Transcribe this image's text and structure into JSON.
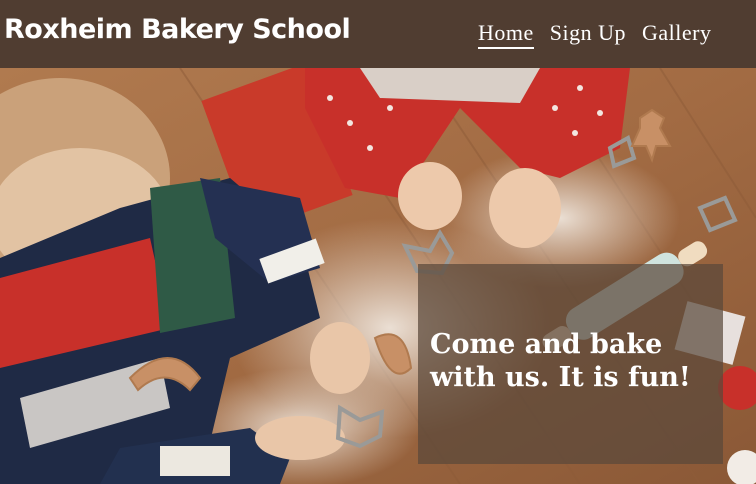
{
  "header": {
    "brand": "Roxheim Bakery School",
    "nav": [
      {
        "label": "Home",
        "active": true
      },
      {
        "label": "Sign Up",
        "active": false
      },
      {
        "label": "Gallery",
        "active": false
      }
    ]
  },
  "hero": {
    "headline": "Come and bake with us. It is fun!"
  },
  "colors": {
    "header_bg": "#503d31",
    "overlay_bg": "rgba(90,72,58,0.72)"
  }
}
